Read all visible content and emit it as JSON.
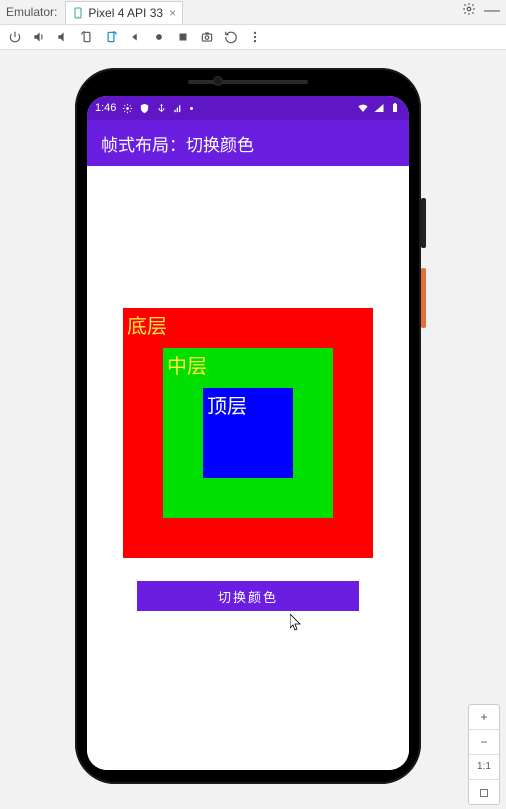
{
  "ide": {
    "emulator_label": "Emulator:",
    "tab_name": "Pixel 4 API 33",
    "zoom": {
      "plus": "+",
      "minus": "−",
      "ratio": "1:1"
    }
  },
  "device": {
    "status": {
      "time": "1:46"
    }
  },
  "app": {
    "title": "帧式布局：切换颜色",
    "layers": {
      "bottom_label": "底层",
      "middle_label": "中层",
      "top_label": "顶层",
      "bottom_color": "#ff0000",
      "middle_color": "#00e000",
      "top_color": "#0000ff"
    },
    "button_label": "切换颜色"
  }
}
